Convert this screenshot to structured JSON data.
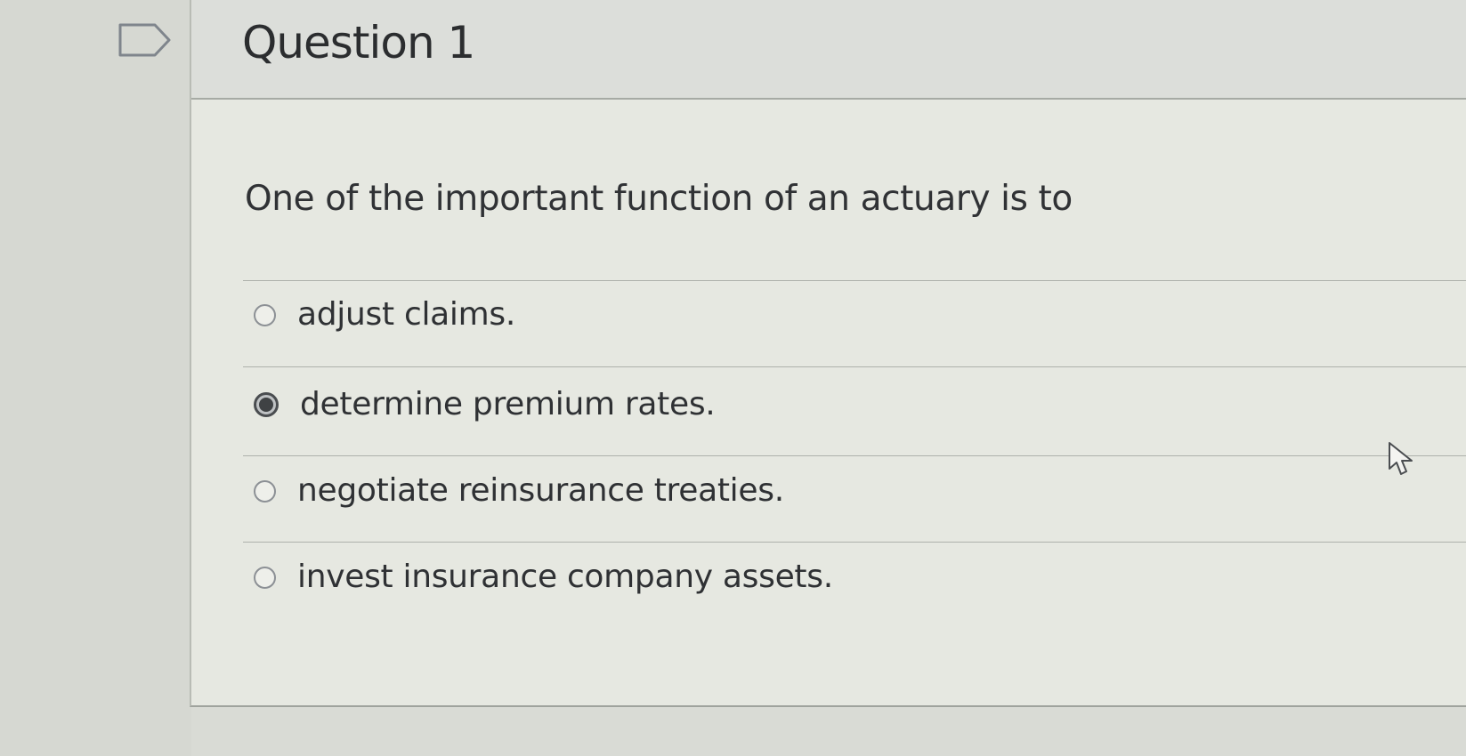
{
  "question": {
    "title": "Question 1",
    "prompt": "One of the important function of an actuary is to",
    "flag_icon": "flag-outline-icon"
  },
  "answers": [
    {
      "label": "adjust claims.",
      "selected": false
    },
    {
      "label": "determine premium rates.",
      "selected": true
    },
    {
      "label": "negotiate reinsurance treaties.",
      "selected": false
    },
    {
      "label": "invest insurance company assets.",
      "selected": false
    }
  ],
  "colors": {
    "page_background": "#d9dbd5",
    "card_background": "#e6e8e1",
    "header_background": "#dcdeda",
    "text": "#2e3032",
    "selected_radio": "#3f4244"
  },
  "cursor": {
    "icon": "mouse-pointer-icon"
  }
}
